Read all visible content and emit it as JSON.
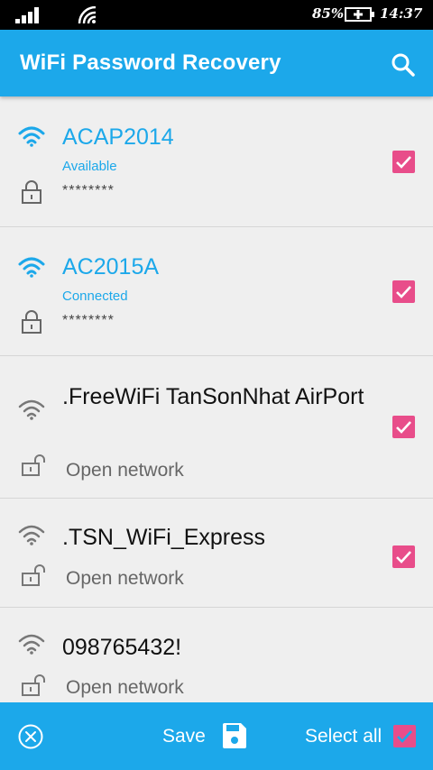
{
  "status_bar": {
    "battery": "85%",
    "time": "14:37"
  },
  "app_bar": {
    "title": "WiFi Password Recovery",
    "search_icon": "search-icon"
  },
  "colors": {
    "primary": "#1ca8ea",
    "checkbox": "#e84d8a",
    "background": "#efefef"
  },
  "networks": [
    {
      "name": "ACAP2014",
      "status": "Available",
      "password": "********",
      "security": "secured",
      "checked": true
    },
    {
      "name": "AC2015A",
      "status": "Connected",
      "password": "********",
      "security": "secured",
      "checked": true
    },
    {
      "name": ".FreeWiFi TanSonNhat AirPort",
      "open_label": "Open network",
      "security": "open",
      "checked": true
    },
    {
      "name": ".TSN_WiFi_Express",
      "open_label": "Open network",
      "security": "open",
      "checked": true
    },
    {
      "name": "098765432!",
      "open_label": "Open network",
      "security": "open",
      "checked": true
    }
  ],
  "bottom_bar": {
    "save_label": "Save",
    "select_all_label": "Select all",
    "select_all_checked": true
  }
}
